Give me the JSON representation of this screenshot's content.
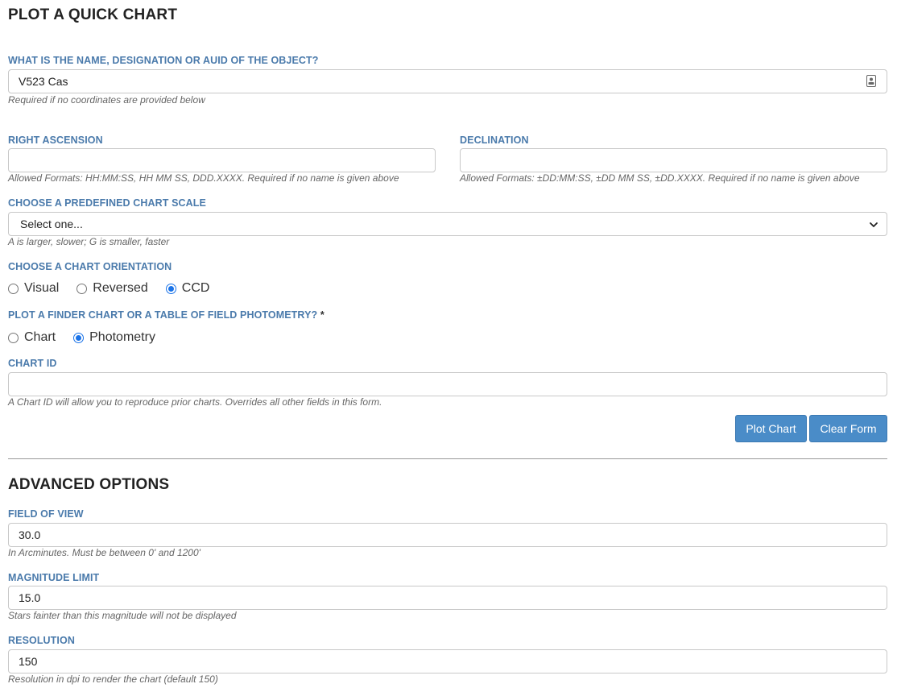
{
  "page_title": "PLOT A QUICK CHART",
  "object": {
    "label": "WHAT IS THE NAME, DESIGNATION OR AUID OF THE OBJECT?",
    "value": "V523 Cas",
    "help": "Required if no coordinates are provided below"
  },
  "ra": {
    "label": "RIGHT ASCENSION",
    "value": "",
    "help": "Allowed Formats: HH:MM:SS, HH MM SS, DDD.XXXX. Required if no name is given above"
  },
  "dec": {
    "label": "DECLINATION",
    "value": "",
    "help": "Allowed Formats: ±DD:MM:SS, ±DD MM SS, ±DD.XXXX. Required if no name is given above"
  },
  "scale": {
    "label": "CHOOSE A PREDEFINED CHART SCALE",
    "selected": "Select one...",
    "help": "A is larger, slower; G is smaller, faster"
  },
  "orientation": {
    "label": "CHOOSE A CHART ORIENTATION",
    "options": [
      "Visual",
      "Reversed",
      "CCD"
    ],
    "selected": "CCD"
  },
  "output": {
    "label": "PLOT A FINDER CHART OR A TABLE OF FIELD PHOTOMETRY?",
    "required_mark": "*",
    "options": [
      "Chart",
      "Photometry"
    ],
    "selected": "Photometry"
  },
  "chart_id": {
    "label": "CHART ID",
    "value": "",
    "help": "A Chart ID will allow you to reproduce prior charts. Overrides all other fields in this form."
  },
  "buttons": {
    "plot": "Plot Chart",
    "clear": "Clear Form"
  },
  "advanced_title": "ADVANCED OPTIONS",
  "fov": {
    "label": "FIELD OF VIEW",
    "value": "30.0",
    "help": "In Arcminutes. Must be between 0' and 1200'"
  },
  "maglimit": {
    "label": "MAGNITUDE LIMIT",
    "value": "15.0",
    "help": "Stars fainter than this magnitude will not be displayed"
  },
  "resolution": {
    "label": "RESOLUTION",
    "value": "150",
    "help": "Resolution in dpi to render the chart (default 150)"
  },
  "colors": {
    "label": "#4a7aab",
    "button": "#4a8cc8",
    "radio_checked": "#1a73e8"
  }
}
